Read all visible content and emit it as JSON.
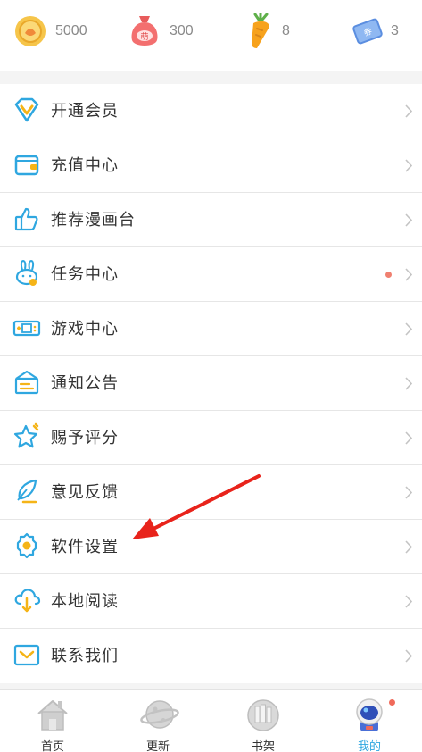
{
  "stats": [
    {
      "icon": "coin-icon",
      "value": "5000"
    },
    {
      "icon": "money-bag-icon",
      "value": "300",
      "bag_text": "萌"
    },
    {
      "icon": "carrot-icon",
      "value": "8"
    },
    {
      "icon": "ticket-icon",
      "value": "3",
      "ticket_text": "券"
    }
  ],
  "menu": [
    {
      "label": "开通会员",
      "icon": "vip-diamond-icon"
    },
    {
      "label": "充值中心",
      "icon": "wallet-icon"
    },
    {
      "label": "推荐漫画台",
      "icon": "thumbs-up-icon"
    },
    {
      "label": "任务中心",
      "icon": "bunny-task-icon",
      "has_dot": true
    },
    {
      "label": "游戏中心",
      "icon": "game-console-icon"
    },
    {
      "label": "通知公告",
      "icon": "notice-board-icon"
    },
    {
      "label": "赐予评分",
      "icon": "star-icon"
    },
    {
      "label": "意见反馈",
      "icon": "feather-pen-icon"
    },
    {
      "label": "软件设置",
      "icon": "gear-icon"
    },
    {
      "label": "本地阅读",
      "icon": "cloud-download-icon"
    },
    {
      "label": "联系我们",
      "icon": "mail-icon"
    }
  ],
  "bottom_nav": [
    {
      "label": "首页",
      "icon": "house-icon",
      "active": false
    },
    {
      "label": "更新",
      "icon": "planet-icon",
      "active": false
    },
    {
      "label": "书架",
      "icon": "bookshelf-icon",
      "active": false
    },
    {
      "label": "我的",
      "icon": "astronaut-icon",
      "active": true,
      "badge": true
    }
  ],
  "colors": {
    "accent_blue": "#2fa7e0",
    "text": "#333333",
    "muted": "#8a8a8a",
    "dot_red": "#f08070",
    "arrow_red": "#e8231b"
  }
}
